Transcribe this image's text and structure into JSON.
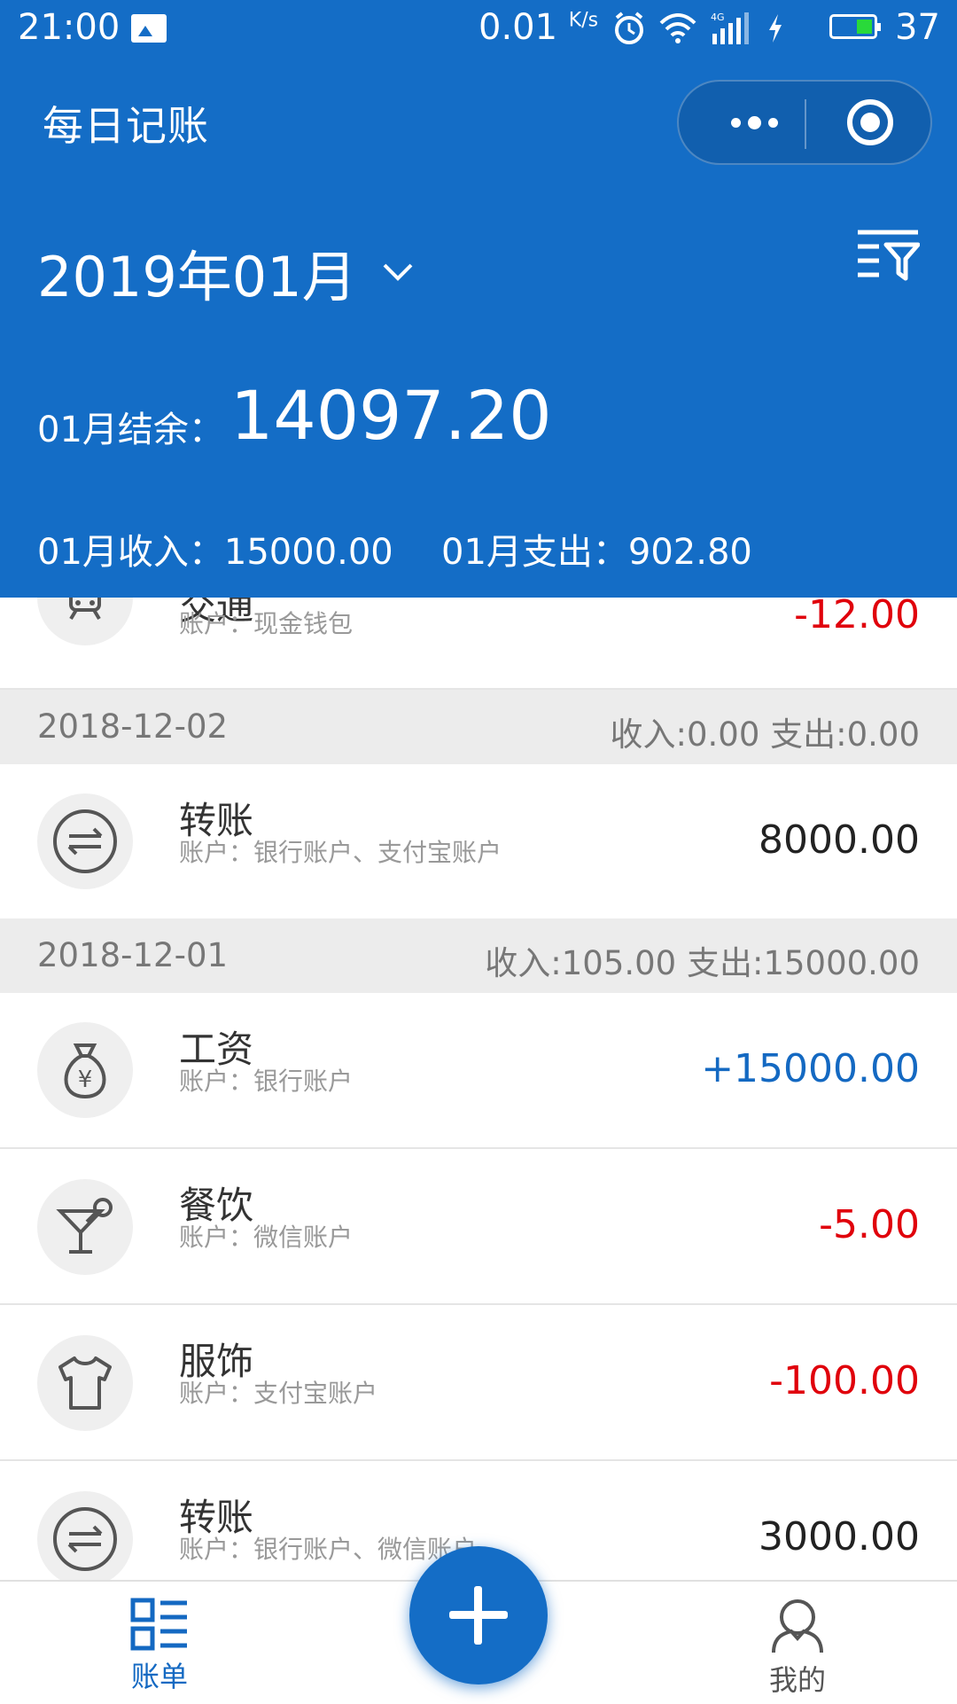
{
  "status": {
    "time": "21:00",
    "speed": "0.01",
    "speed_unit": "K/s",
    "network": "4G",
    "battery": "37"
  },
  "header": {
    "title": "每日记账",
    "month": "2019年01月"
  },
  "summary": {
    "balance_label": "01月结余：",
    "balance_value": "14097.20",
    "income_label": "01月收入：15000.00",
    "expense_label": "01月支出：902.80"
  },
  "entries": [
    {
      "name": "交通",
      "account": "账户：现金钱包",
      "amount": "-12.00",
      "type": "neg",
      "icon": "train-icon"
    },
    {
      "date": "2018-12-02",
      "summary": "收入:0.00 支出:0.00"
    },
    {
      "name": "转账",
      "account": "账户：银行账户、支付宝账户",
      "amount": "8000.00",
      "type": "neutral",
      "icon": "transfer-icon"
    },
    {
      "date": "2018-12-01",
      "summary": "收入:105.00 支出:15000.00"
    },
    {
      "name": "工资",
      "account": "账户：银行账户",
      "amount": "+15000.00",
      "type": "pos",
      "icon": "money-bag-icon"
    },
    {
      "name": "餐饮",
      "account": "账户：微信账户",
      "amount": "-5.00",
      "type": "neg",
      "icon": "cocktail-icon"
    },
    {
      "name": "服饰",
      "account": "账户：支付宝账户",
      "amount": "-100.00",
      "type": "neg",
      "icon": "tshirt-icon"
    },
    {
      "name": "转账",
      "account": "账户：银行账户、微信账户",
      "amount": "3000.00",
      "type": "neutral",
      "icon": "transfer-icon"
    }
  ],
  "tabs": {
    "bills": "账单",
    "me": "我的"
  },
  "colors": {
    "primary": "#146dc6",
    "expense": "#e0000b",
    "income": "#1469c2"
  }
}
